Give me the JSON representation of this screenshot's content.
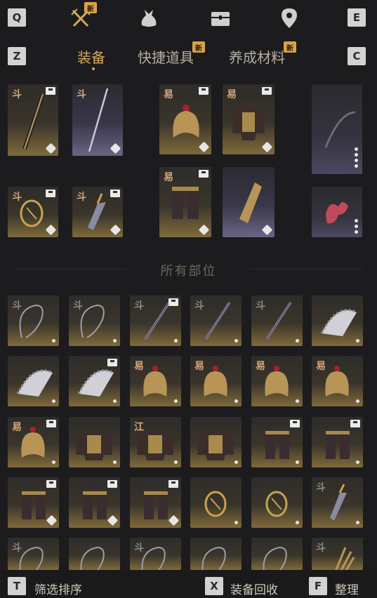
{
  "topbar": {
    "key_left": "Q",
    "key_right": "E",
    "badge": "新",
    "icons": [
      "crossed-swords-icon",
      "money-bag-icon",
      "chest-icon",
      "location-pin-icon"
    ]
  },
  "tabs": {
    "key_left": "Z",
    "key_right": "C",
    "items": [
      {
        "label": "装备",
        "active": true
      },
      {
        "label": "快捷道具",
        "badge": "新"
      },
      {
        "label": "养成材料",
        "badge": "新"
      }
    ]
  },
  "equipped_glyphs": [
    "斗",
    "斗",
    "斗",
    "斗",
    "易",
    "易",
    "易"
  ],
  "section_title": "所有部位",
  "grid_glyphs": [
    [
      "斗",
      "斗",
      "斗",
      "斗",
      "斗",
      ""
    ],
    [
      "",
      "",
      "易",
      "易",
      "易",
      "易"
    ],
    [
      "易",
      "",
      "江",
      "",
      "",
      ""
    ],
    [
      "",
      "",
      "",
      "",
      "",
      "斗"
    ],
    [
      "斗",
      "",
      "斗",
      "",
      "",
      "斗"
    ]
  ],
  "footer": {
    "filter_key": "T",
    "filter_label": "筛选排序",
    "recycle_key": "X",
    "recycle_label": "装备回收",
    "sort_key": "F",
    "sort_label": "整理"
  },
  "colors": {
    "accent": "#d8a65a",
    "background": "#1c1c1e",
    "badge": "#d9a24a"
  }
}
